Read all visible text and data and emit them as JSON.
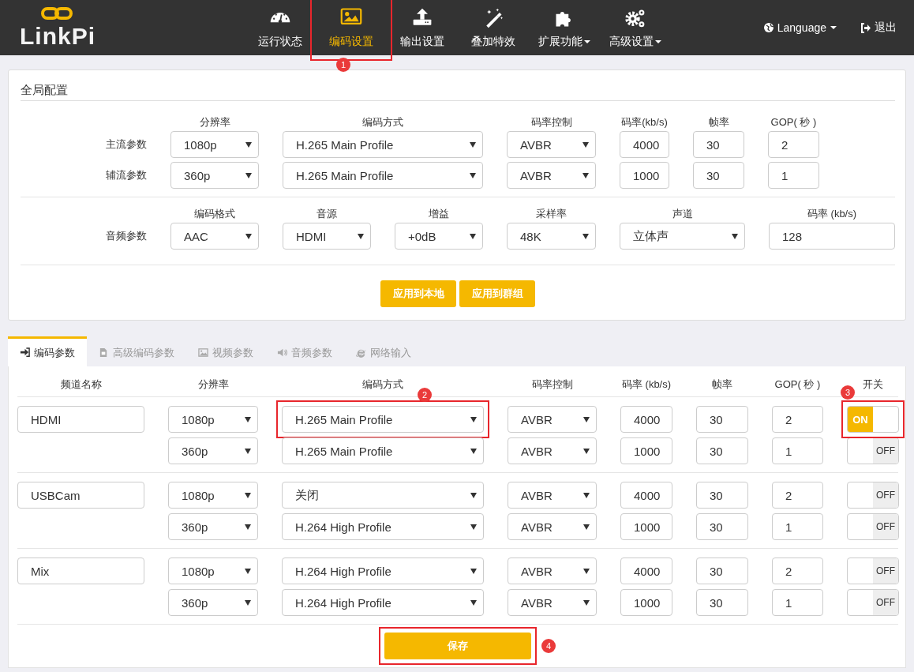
{
  "header": {
    "logo": "LinkPi",
    "nav": [
      {
        "label": "运行状态",
        "selected": false,
        "dropdown": false
      },
      {
        "label": "编码设置",
        "selected": true,
        "dropdown": false,
        "marker": "1"
      },
      {
        "label": "输出设置",
        "selected": false,
        "dropdown": false
      },
      {
        "label": "叠加特效",
        "selected": false,
        "dropdown": false
      },
      {
        "label": "扩展功能",
        "selected": false,
        "dropdown": true
      },
      {
        "label": "高级设置",
        "selected": false,
        "dropdown": true
      }
    ],
    "language": "Language",
    "logout": "退出"
  },
  "global": {
    "title": "全局配置",
    "video_columns": [
      {
        "label": "分辨率",
        "kind": "select"
      },
      {
        "label": "编码方式",
        "kind": "select"
      },
      {
        "label": "码率控制",
        "kind": "select"
      },
      {
        "label": "码率(kb/s)",
        "kind": "input"
      },
      {
        "label": "帧率",
        "kind": "input"
      },
      {
        "label": "GOP( 秒 )",
        "kind": "input"
      }
    ],
    "video_rows": [
      {
        "label": "主流参数",
        "values": [
          "1080p",
          "H.265 Main Profile",
          "AVBR",
          "4000",
          "30",
          "2"
        ]
      },
      {
        "label": "辅流参数",
        "values": [
          "360p",
          "H.265 Main Profile",
          "AVBR",
          "1000",
          "30",
          "1"
        ]
      }
    ],
    "audio_columns": [
      {
        "label": "编码格式",
        "kind": "select"
      },
      {
        "label": "音源",
        "kind": "select"
      },
      {
        "label": "增益",
        "kind": "select"
      },
      {
        "label": "采样率",
        "kind": "select"
      },
      {
        "label": "声道",
        "kind": "select"
      },
      {
        "label": "码率 (kb/s)",
        "kind": "input"
      }
    ],
    "audio_row": {
      "label": "音频参数",
      "values": [
        "AAC",
        "HDMI",
        "+0dB",
        "48K",
        "立体声",
        "128"
      ]
    },
    "buttons": [
      "应用到本地",
      "应用到群组"
    ]
  },
  "tabs": [
    {
      "label": "编码参数",
      "selected": true
    },
    {
      "label": "高级编码参数",
      "selected": false
    },
    {
      "label": "视频参数",
      "selected": false
    },
    {
      "label": "音频参数",
      "selected": false
    },
    {
      "label": "网络输入",
      "selected": false
    }
  ],
  "channel_columns": [
    "频道名称",
    "分辨率",
    "编码方式",
    "码率控制",
    "码率 (kb/s)",
    "帧率",
    "GOP( 秒 )",
    "开关"
  ],
  "channels": [
    {
      "name": "HDMI",
      "streams": [
        {
          "resolution": "1080p",
          "encoding": "H.265 Main Profile",
          "rate_control": "AVBR",
          "bitrate": "4000",
          "fps": "30",
          "gop": "2",
          "on": true,
          "switch_label": "ON",
          "encoding_marker": "2",
          "switch_marker": "3"
        },
        {
          "resolution": "360p",
          "encoding": "H.265 Main Profile",
          "rate_control": "AVBR",
          "bitrate": "1000",
          "fps": "30",
          "gop": "1",
          "on": false,
          "switch_label": "OFF"
        }
      ]
    },
    {
      "name": "USBCam",
      "streams": [
        {
          "resolution": "1080p",
          "encoding": "关闭",
          "rate_control": "AVBR",
          "bitrate": "4000",
          "fps": "30",
          "gop": "2",
          "on": false,
          "switch_label": "OFF"
        },
        {
          "resolution": "360p",
          "encoding": "H.264 High Profile",
          "rate_control": "AVBR",
          "bitrate": "1000",
          "fps": "30",
          "gop": "1",
          "on": false,
          "switch_label": "OFF"
        }
      ]
    },
    {
      "name": "Mix",
      "streams": [
        {
          "resolution": "1080p",
          "encoding": "H.264 High Profile",
          "rate_control": "AVBR",
          "bitrate": "4000",
          "fps": "30",
          "gop": "2",
          "on": false,
          "switch_label": "OFF"
        },
        {
          "resolution": "360p",
          "encoding": "H.264 High Profile",
          "rate_control": "AVBR",
          "bitrate": "1000",
          "fps": "30",
          "gop": "1",
          "on": false,
          "switch_label": "OFF"
        }
      ]
    }
  ],
  "save_button": {
    "label": "保存",
    "marker": "4"
  }
}
